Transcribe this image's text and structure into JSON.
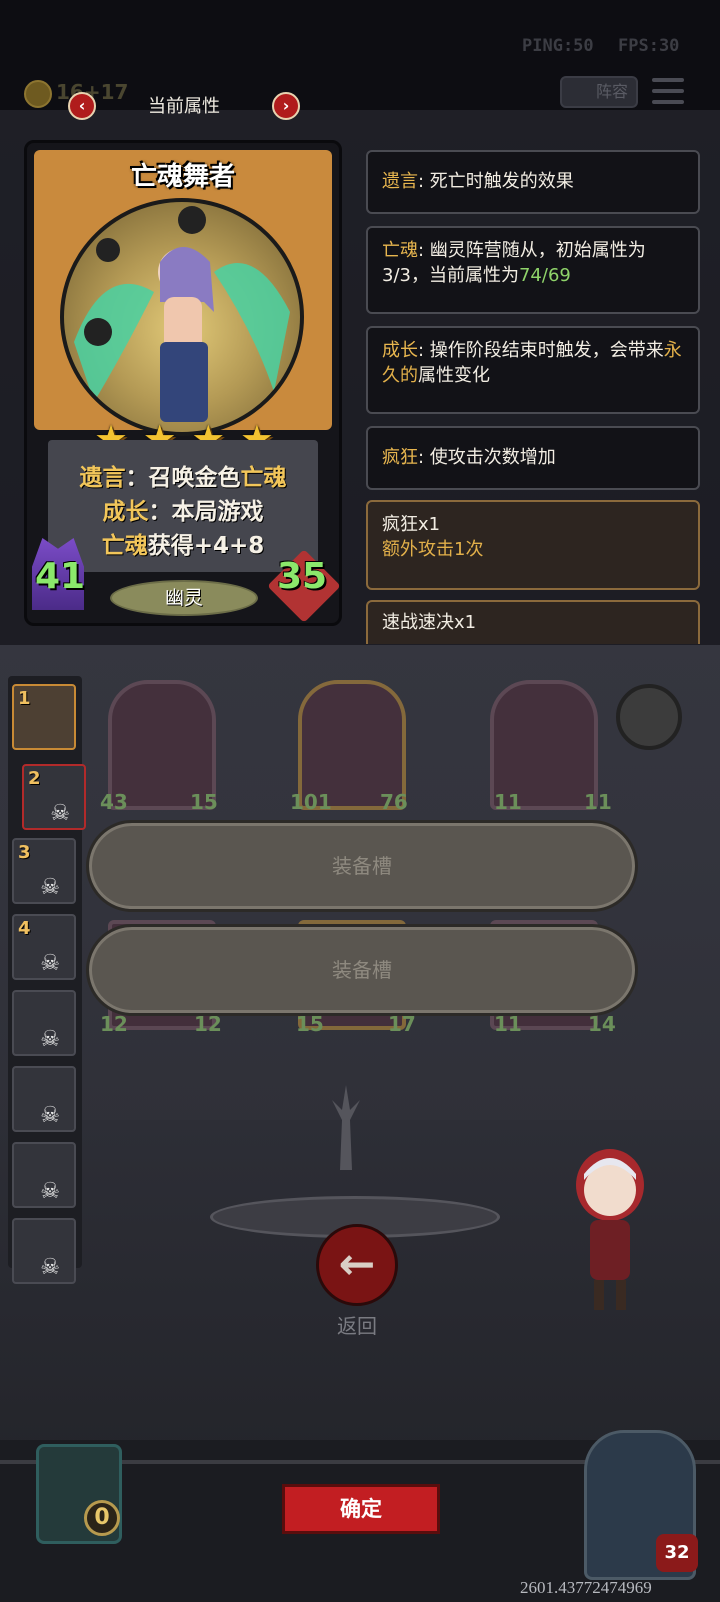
{
  "hud": {
    "ping": "PING:50",
    "fps": "FPS:30",
    "coins": "16+17",
    "lineup_label": "阵容"
  },
  "header": {
    "title": "当前属性",
    "prev": "‹",
    "next": "›"
  },
  "card": {
    "name": "亡魂舞者",
    "stars": 4,
    "star_glyph": "★",
    "line1_key": "遗言",
    "line1_mid": "：召唤金色",
    "line1_hl": "亡魂",
    "line2_key": "成长",
    "line2_text": "：本局游戏",
    "line3_hl": "亡魂",
    "line3_text": "获得+4+8",
    "attack": "41",
    "health": "35",
    "tribe": "幽灵"
  },
  "keywords": [
    {
      "key": "遗言",
      "text": ": 死亡时触发的效果"
    },
    {
      "key": "亡魂",
      "text": ": 幽灵阵营随从，初始属性为3/3，当前属性为",
      "value": "74/69"
    },
    {
      "key": "成长",
      "text_a": ": 操作阶段结束时触发，会带来",
      "hl": "永久的",
      "text_b": "属性变化"
    },
    {
      "key": "疯狂",
      "text": ": 使攻击次数增加"
    }
  ],
  "buffs": [
    {
      "title": "疯狂x1",
      "sub": "额外攻击1次"
    },
    {
      "title": "速战速决x1"
    }
  ],
  "team": {
    "slots": [
      "1",
      "2",
      "3",
      "4",
      "",
      "",
      "",
      ""
    ]
  },
  "board": {
    "stats": [
      "12",
      "12",
      "15",
      "17",
      "11",
      "14",
      "43",
      "15",
      "101",
      "76",
      "11",
      "11"
    ]
  },
  "equipment": {
    "slot1": "装备槽",
    "slot2": "装备槽"
  },
  "actions": {
    "back_label": "返回",
    "back_glyph": "←",
    "confirm": "确定"
  },
  "bottom": {
    "gold_count": "0",
    "hero_hp": "32",
    "coord_readout": "2601.43772474969"
  },
  "colors": {
    "accent_red": "#c21e22",
    "keyword_gold": "#e8b64f",
    "value_green": "#8fd36a"
  }
}
